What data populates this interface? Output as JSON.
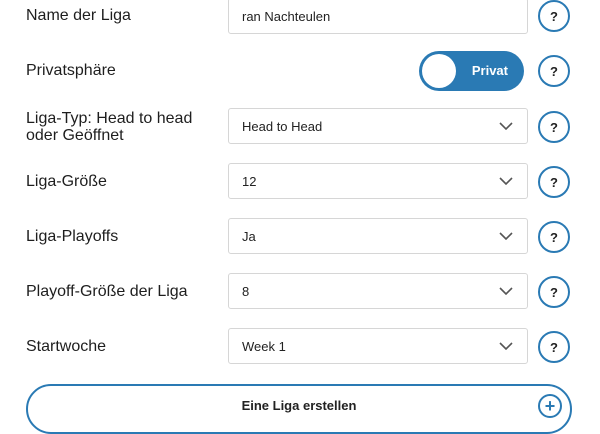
{
  "fields": {
    "league_name": {
      "label": "Name der Liga",
      "value": "ran Nachteulen"
    },
    "privacy": {
      "label": "Privatsphäre",
      "toggle_label": "Privat"
    },
    "league_type": {
      "label": "Liga-Typ: Head to head oder Geöffnet",
      "value": "Head to Head"
    },
    "league_size": {
      "label": "Liga-Größe",
      "value": "12"
    },
    "league_playoffs": {
      "label": "Liga-Playoffs",
      "value": "Ja"
    },
    "playoff_size": {
      "label": "Playoff-Größe der Liga",
      "value": "8"
    },
    "start_week": {
      "label": "Startwoche",
      "value": "Week 1"
    }
  },
  "help_label": "?",
  "create_button": {
    "label": "Eine Liga erstellen",
    "icon": "plus-circle-icon"
  },
  "colors": {
    "accent": "#2a7ab4",
    "border": "#d6d6d6"
  }
}
